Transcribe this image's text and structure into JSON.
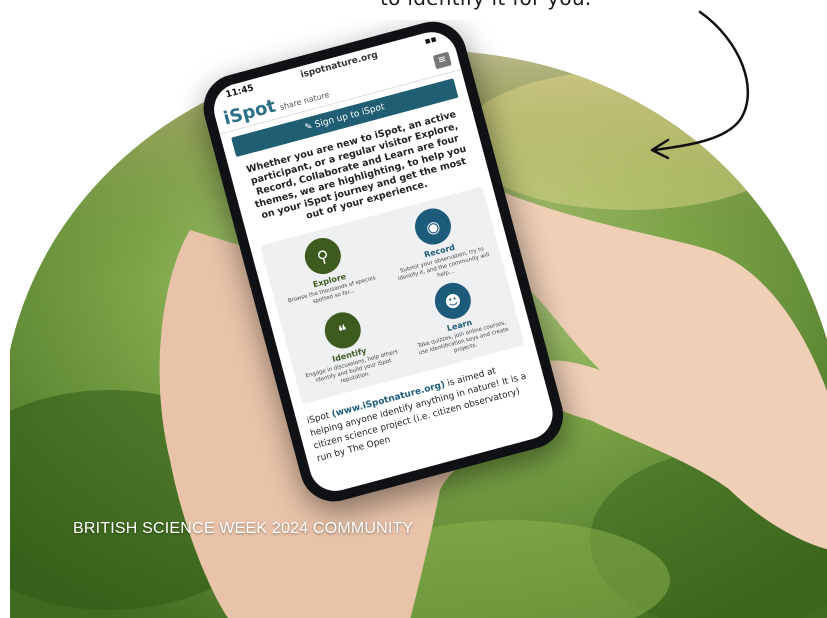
{
  "caption_top": "to identify it for you.",
  "bottom_caption": "BRITISH SCIENCE WEEK 2024 COMMUNITY",
  "colors": {
    "brand": "#1f5e73",
    "explore_green": "#3d5a1f",
    "record_blue": "#1d5b7a"
  },
  "phone": {
    "status_time": "11:45",
    "url": "ispotnature.org",
    "logo": "iSpot",
    "logo_tagline": "share nature",
    "menu_icon": "hamburger-icon",
    "signup_label": "Sign up to iSpot",
    "intro_text": "Whether you are new to iSpot, an active participant, or a regular visitor Explore, Record, Collaborate and Learn are four themes, we are highlighting, to help you on your iSpot journey and get the most out of your experience.",
    "tiles": [
      {
        "icon": "magnifier-icon",
        "title": "Explore",
        "desc": "Browse the thousands of species spotted so far..."
      },
      {
        "icon": "camera-icon",
        "title": "Record",
        "desc": "Submit your observation, try to identify it, and the community will help..."
      },
      {
        "icon": "speech-bubbles-icon",
        "title": "Identify",
        "desc": "Engage in discussions, help others identify and build your iSpot reputation."
      },
      {
        "icon": "head-icon",
        "title": "Learn",
        "desc": "Take quizzes, join online courses, use identification keys and create projects."
      }
    ],
    "about_prefix": "iSpot ",
    "about_link": "(www.iSpotnature.org)",
    "about_rest": " is aimed at helping anyone identify anything in nature! It is a citizen science project (i.e. citizen observatory) run by The Open"
  }
}
